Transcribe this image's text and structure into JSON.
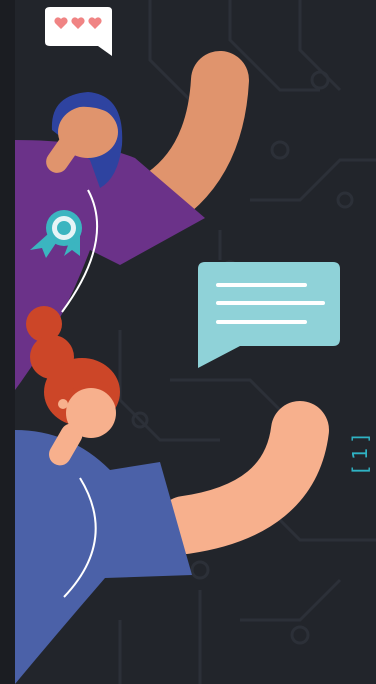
{
  "page_indicator": {
    "text": "[1]"
  },
  "colors": {
    "background": "#22252b",
    "circuit_lines": "#2c3038",
    "purple_shirt": "#6b3289",
    "blue_shirt": "#4b61a8",
    "skin_tan": "#e0946d",
    "skin_peach": "#f7b08d",
    "navy_hair": "#2e43a0",
    "red_hair": "#cc4628",
    "chat_bubble": "#8fd2d8",
    "heart_pink": "#f08484",
    "badge_teal": "#3bb5c0",
    "accent_cyan": "#2fb3c4"
  },
  "icons": [
    "speech-bubble-hearts-icon",
    "chat-bubble-icon",
    "award-ribbon-icon"
  ]
}
